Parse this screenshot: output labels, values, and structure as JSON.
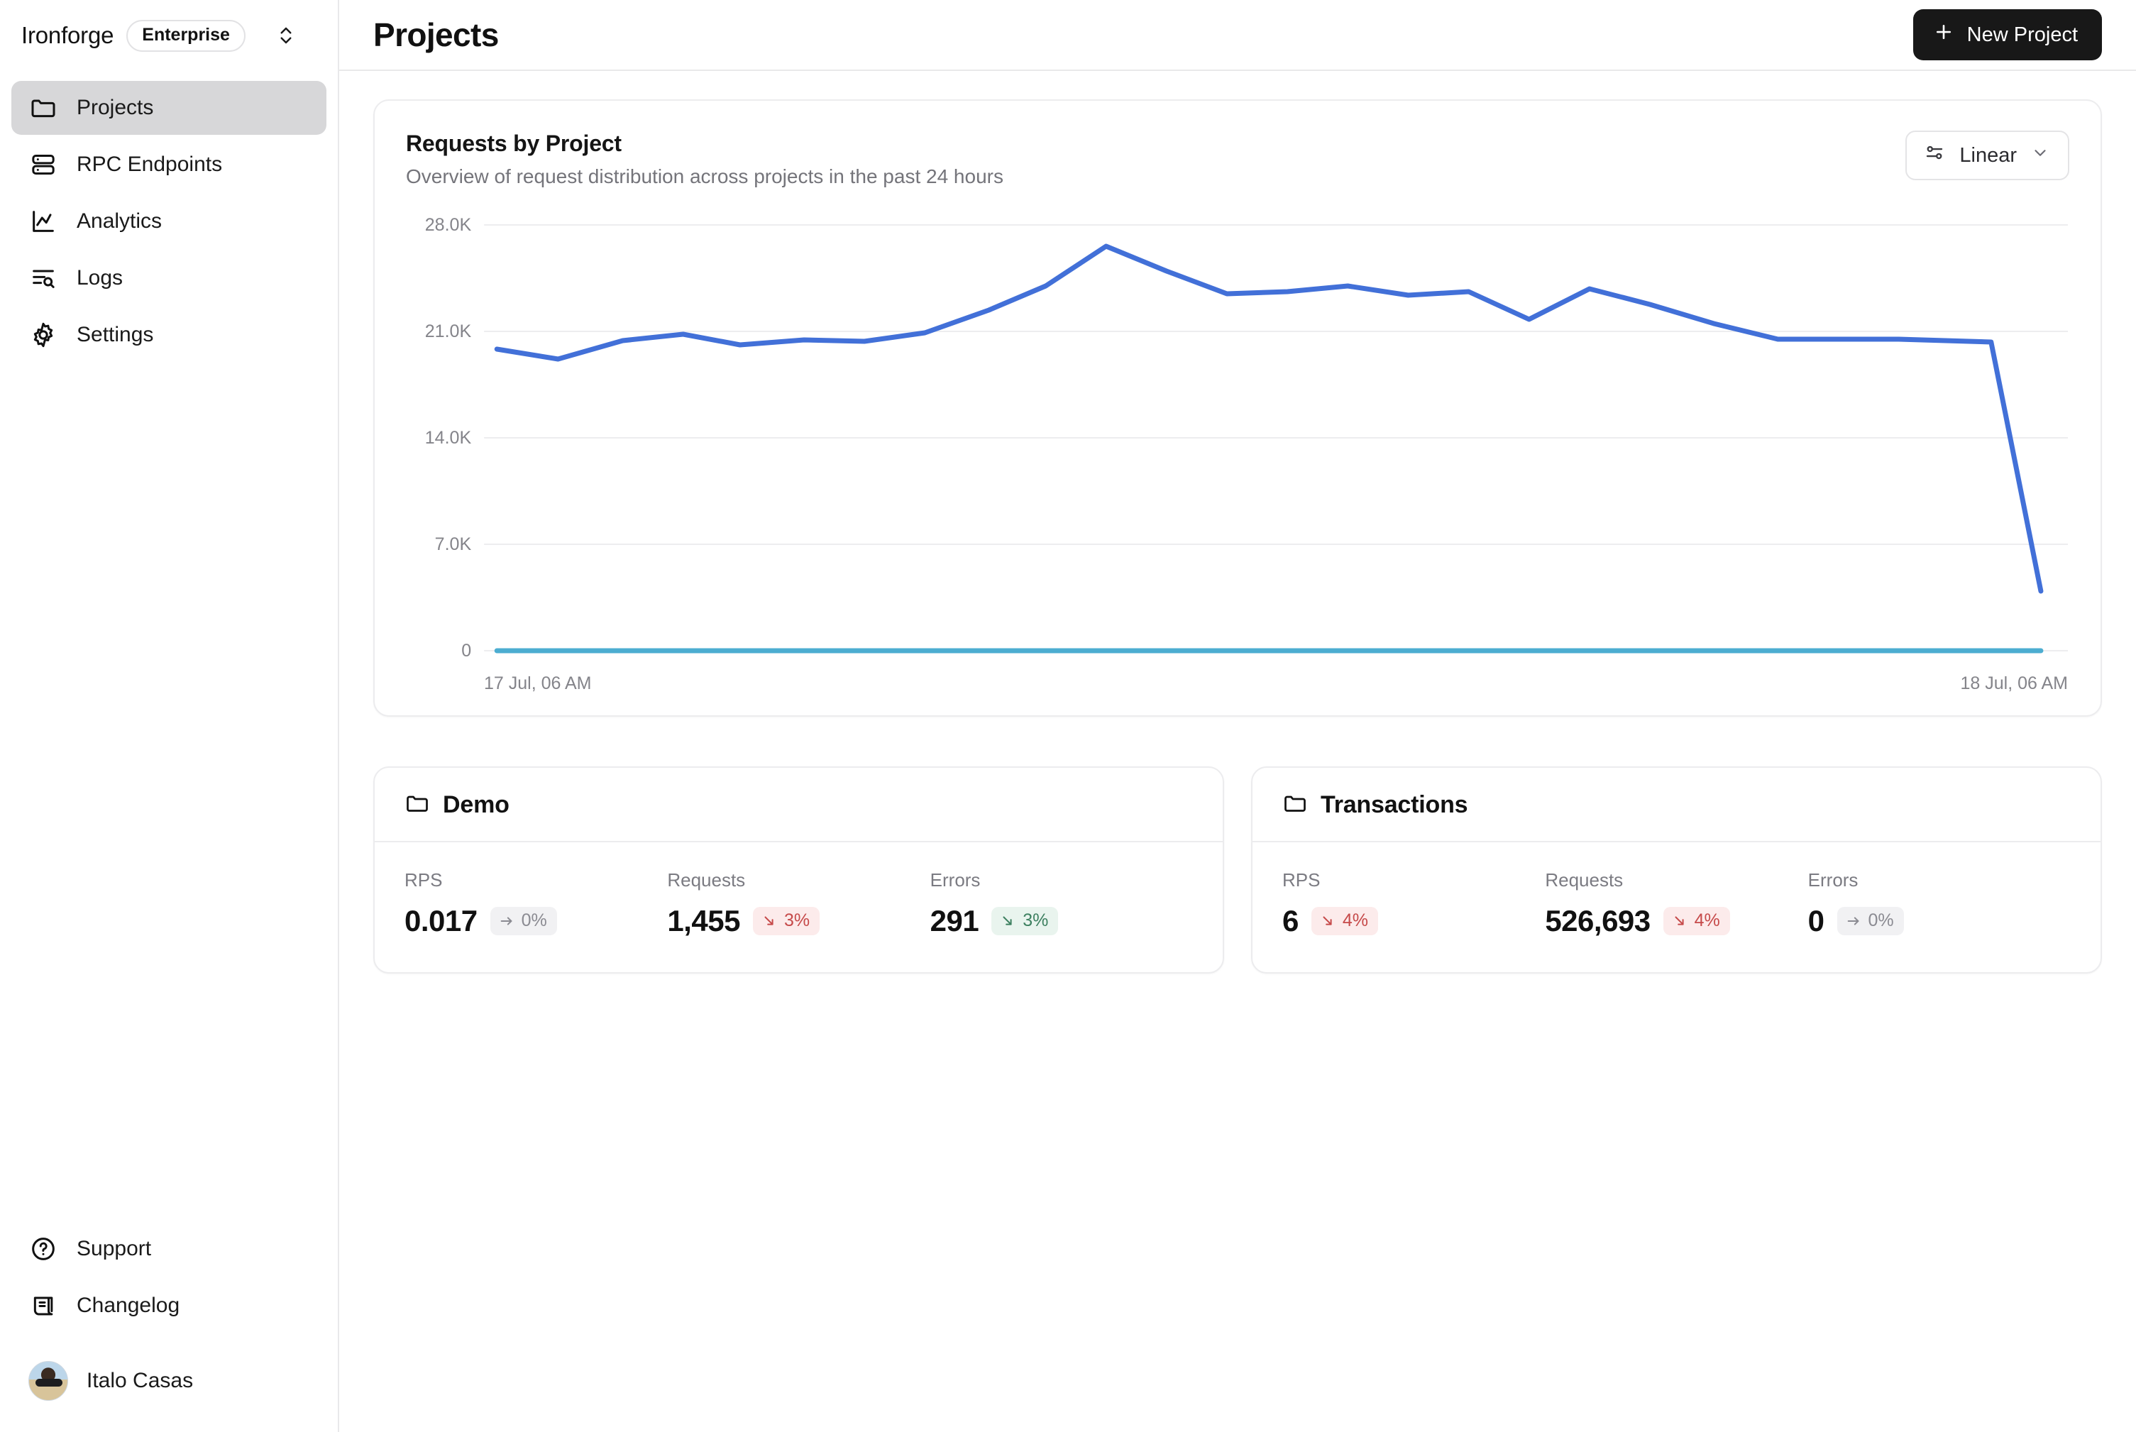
{
  "sidebar": {
    "org": {
      "name": "Ironforge",
      "plan_badge": "Enterprise",
      "switcher_icon": "chevron-up-down-icon"
    },
    "items": [
      {
        "label": "Projects",
        "icon": "folder-icon",
        "active": true
      },
      {
        "label": "RPC Endpoints",
        "icon": "server-icon",
        "active": false
      },
      {
        "label": "Analytics",
        "icon": "chart-line-icon",
        "active": false
      },
      {
        "label": "Logs",
        "icon": "log-search-icon",
        "active": false
      },
      {
        "label": "Settings",
        "icon": "gear-icon",
        "active": false
      }
    ],
    "bottom_items": [
      {
        "label": "Support",
        "icon": "question-circle-icon"
      },
      {
        "label": "Changelog",
        "icon": "scroll-icon"
      }
    ],
    "user": {
      "name": "Italo Casas",
      "avatar": "avatar-photo"
    }
  },
  "header": {
    "title": "Projects",
    "new_project_label": "New Project",
    "new_project_icon": "plus-icon"
  },
  "chart_card": {
    "title": "Requests by Project",
    "subtitle": "Overview of request distribution across projects in the past 24 hours",
    "scale": {
      "label": "Linear",
      "icon": "sliders-icon",
      "chevron": "chevron-down-icon"
    }
  },
  "chart_data": {
    "type": "line",
    "title": "Requests by Project",
    "subtitle": "Overview of request distribution across projects in the past 24 hours",
    "xlabel": "",
    "ylabel": "",
    "ylim": [
      0,
      28000
    ],
    "y_ticks": [
      0,
      7000,
      14000,
      21000,
      28000
    ],
    "y_tick_labels": [
      "0",
      "7.0K",
      "14.0K",
      "21.0K",
      "28.0K"
    ],
    "x_tick_labels": [
      "17 Jul, 06 AM",
      "18 Jul, 06 AM"
    ],
    "x_range": [
      "17 Jul, 06 AM",
      "18 Jul, 06 AM"
    ],
    "grid": true,
    "legend": "none",
    "series": [
      {
        "name": "Transactions",
        "color": "#4270d8",
        "x": [
          0,
          4,
          9,
          13,
          17,
          22,
          26,
          30,
          35,
          39,
          44,
          48,
          52,
          57,
          61,
          65,
          70,
          74,
          78,
          83,
          87,
          91,
          96,
          100
        ],
        "values": [
          19850,
          19200,
          20400,
          20800,
          20100,
          20450,
          20350,
          20900,
          22300,
          23900,
          26500,
          24900,
          23400,
          23550,
          23900,
          23300,
          23550,
          21500,
          23700,
          22600,
          21200,
          20200,
          20200,
          20000,
          2600
        ]
      },
      {
        "name": "Demo",
        "color": "#4cadd1",
        "x": [
          0,
          100
        ],
        "values": [
          0,
          0
        ]
      }
    ]
  },
  "projects": [
    {
      "name": "Demo",
      "icon": "folder-icon",
      "stats": [
        {
          "label": "RPS",
          "value": "0.017",
          "delta": "0%",
          "trend": "flat",
          "trend_icon": "arrow-right-icon"
        },
        {
          "label": "Requests",
          "value": "1,455",
          "delta": "3%",
          "trend": "down-red",
          "trend_icon": "arrow-down-right-icon"
        },
        {
          "label": "Errors",
          "value": "291",
          "delta": "3%",
          "trend": "down-green",
          "trend_icon": "arrow-down-right-icon"
        }
      ]
    },
    {
      "name": "Transactions",
      "icon": "folder-icon",
      "stats": [
        {
          "label": "RPS",
          "value": "6",
          "delta": "4%",
          "trend": "down-red",
          "trend_icon": "arrow-down-right-icon"
        },
        {
          "label": "Requests",
          "value": "526,693",
          "delta": "4%",
          "trend": "down-red",
          "trend_icon": "arrow-down-right-icon"
        },
        {
          "label": "Errors",
          "value": "0",
          "delta": "0%",
          "trend": "flat",
          "trend_icon": "arrow-right-icon"
        }
      ]
    }
  ],
  "colors": {
    "accent_line": "#4270d8",
    "secondary_line": "#4cadd1",
    "active_nav_bg": "#d7d7d9",
    "button_bg": "#181818",
    "red": "#c64a4a",
    "green": "#3d8060"
  }
}
